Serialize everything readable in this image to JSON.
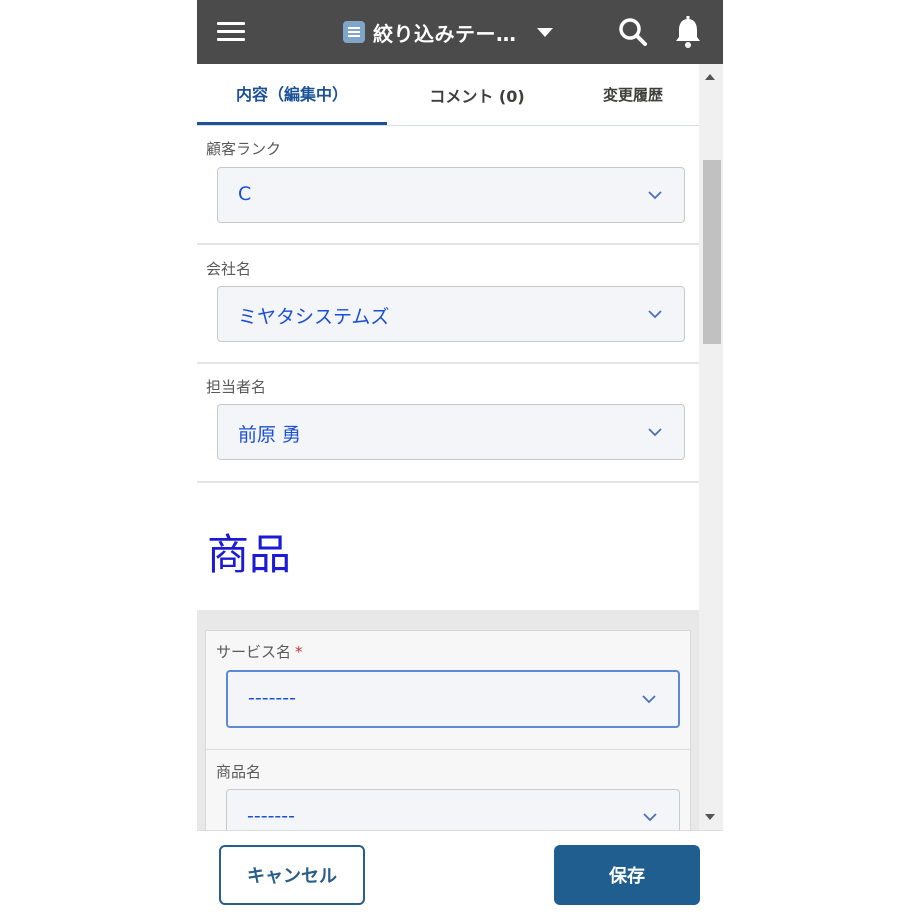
{
  "appbar": {
    "title": "絞り込みテー…",
    "icons": [
      "menu-icon",
      "list-icon",
      "caret-down-icon",
      "search-icon",
      "bell-icon"
    ]
  },
  "tabs": [
    {
      "label": "内容（編集中）",
      "active": true
    },
    {
      "label": "コメント (0)",
      "active": false
    },
    {
      "label": "変更履歴",
      "active": false
    }
  ],
  "fields": {
    "customer_rank": {
      "label": "顧客ランク",
      "value": "C"
    },
    "company_name": {
      "label": "会社名",
      "value": "ミヤタシステムズ"
    },
    "person_in_charge": {
      "label": "担当者名",
      "value": "前原 勇"
    }
  },
  "section": {
    "title": "商品",
    "service_name": {
      "label": "サービス名",
      "required_mark": "*",
      "value": "-------"
    },
    "product_name": {
      "label": "商品名",
      "value": "-------"
    }
  },
  "footer": {
    "cancel_label": "キャンセル",
    "save_label": "保存"
  },
  "colors": {
    "appbar_bg": "#4b4b4b",
    "accent": "#1b5297",
    "value_text": "#1b4fd6",
    "save_button": "#1f5e8e"
  }
}
